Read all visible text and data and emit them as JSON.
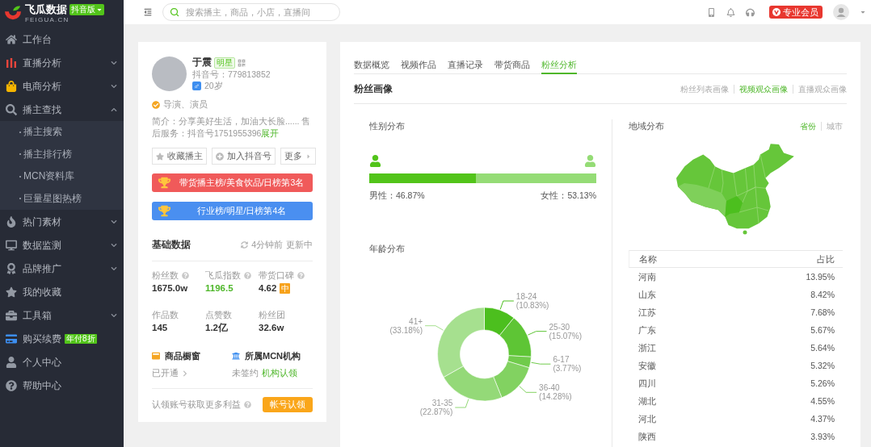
{
  "logo": {
    "name": "飞瓜数据",
    "edition": "抖音版",
    "domain": "FEIGUA.CN"
  },
  "sidebar": {
    "items": [
      {
        "label": "工作台"
      },
      {
        "label": "直播分析",
        "expanded": false
      },
      {
        "label": "电商分析",
        "expanded": false
      },
      {
        "label": "播主查找",
        "expanded": true,
        "children": [
          {
            "label": "播主搜索"
          },
          {
            "label": "播主排行榜"
          },
          {
            "label": "MCN资料库"
          },
          {
            "label": "巨量星图热榜"
          }
        ]
      },
      {
        "label": "热门素材",
        "expanded": false
      },
      {
        "label": "数据监测",
        "expanded": false
      },
      {
        "label": "品牌推广",
        "expanded": false
      },
      {
        "label": "我的收藏"
      },
      {
        "label": "工具箱",
        "expanded": false
      },
      {
        "label": "购买续费",
        "badge": "年付8折"
      },
      {
        "label": "个人中心"
      },
      {
        "label": "帮助中心"
      }
    ]
  },
  "topbar": {
    "search": {
      "placeholder": "搜索播主，商品，小店，直播间"
    },
    "membership": "专业会员"
  },
  "profile": {
    "name": "于震",
    "tag": "明星",
    "account_id": "抖音号：779813852",
    "gender_symbol": "♂",
    "age": "20岁",
    "verified": "导演、演员",
    "bio": "简介：分享美好生活，加油大长脸...... 售后服务：抖音号1751955396",
    "bio_link": "展开",
    "actions": [
      {
        "label": "收藏播主",
        "kind": "favorite"
      },
      {
        "label": "加入抖音号",
        "kind": "add"
      },
      {
        "label": "更多",
        "kind": "more"
      }
    ],
    "ranks": [
      {
        "label": "带货播主榜/美食饮品/日榜第3名",
        "color": "#f05a5a"
      },
      {
        "label": "行业榜/明星/日榜第4名",
        "color": "#4a8ff0"
      }
    ]
  },
  "basic_data": {
    "title": "基础数据",
    "updated": "4分钟前",
    "status": "更新中",
    "stats": [
      {
        "label": "粉丝数",
        "value": "1675.0w",
        "help": true,
        "highlight": false
      },
      {
        "label": "飞瓜指数",
        "value": "1196.5",
        "help": true,
        "highlight": true
      },
      {
        "label": "带货口碑",
        "value": "4.62",
        "help": true,
        "highlight": false,
        "badge": "中"
      },
      {
        "label": "作品数",
        "value": "145",
        "help": false,
        "highlight": false
      },
      {
        "label": "点赞数",
        "value": "1.2亿",
        "help": false,
        "highlight": false
      },
      {
        "label": "粉丝团",
        "value": "32.6w",
        "help": false,
        "highlight": false
      }
    ],
    "services": [
      {
        "kind": "shop",
        "title": "商品橱窗",
        "status": "已开通"
      },
      {
        "kind": "mcn",
        "title": "所属MCN机构",
        "status": "未签约",
        "link": "机构认领"
      }
    ],
    "claim": {
      "text": "认领账号获取更多利益",
      "button": "帐号认领"
    }
  },
  "analysis": {
    "tabs": [
      {
        "label": "数据概览",
        "selected": false
      },
      {
        "label": "视频作品",
        "selected": false
      },
      {
        "label": "直播记录",
        "selected": false
      },
      {
        "label": "带货商品",
        "selected": false
      },
      {
        "label": "粉丝分析",
        "selected": true
      }
    ],
    "section": {
      "title": "粉丝画像",
      "views": [
        {
          "label": "粉丝列表画像",
          "selected": false
        },
        {
          "label": "视频观众画像",
          "selected": true
        },
        {
          "label": "直播观众画像",
          "selected": false
        }
      ]
    },
    "gender": {
      "title": "性别分布",
      "level": 0.4687,
      "male_label": "男性：46.87%",
      "female_label": "女性：53.13%"
    },
    "age": {
      "chart_data": {
        "type": "donut",
        "title": "年龄分布",
        "categories": [
          "18-24",
          "25-30",
          "6-17",
          "36-40",
          "31-35",
          "41+"
        ],
        "series": [
          {
            "values": [
              10.83,
              15.07,
              3.77,
              14.28,
              22.87,
              33.18
            ]
          }
        ],
        "colors": [
          "#4cbf1e",
          "#5ec535",
          "#70cb4b",
          "#82d261",
          "#94d978",
          "#a6e08f"
        ],
        "value_labels": [
          "(10.83%)",
          "(15.07%)",
          "(3.77%)",
          "(14.28%)",
          "(22.87%)",
          "(33.18%)"
        ]
      }
    },
    "region": {
      "title": "地域分布",
      "toggles": [
        {
          "label": "省份",
          "selected": true
        },
        {
          "label": "城市",
          "selected": false
        }
      ],
      "columns": [
        "名称",
        "占比"
      ],
      "rows": [
        {
          "name": "河南",
          "share": "13.95%"
        },
        {
          "name": "山东",
          "share": "8.42%"
        },
        {
          "name": "江苏",
          "share": "7.68%"
        },
        {
          "name": "广东",
          "share": "5.67%"
        },
        {
          "name": "浙江",
          "share": "5.64%"
        },
        {
          "name": "安徽",
          "share": "5.32%"
        },
        {
          "name": "四川",
          "share": "5.26%"
        },
        {
          "name": "湖北",
          "share": "4.55%"
        },
        {
          "name": "河北",
          "share": "4.37%"
        },
        {
          "name": "陕西",
          "share": "3.93%"
        }
      ]
    }
  }
}
